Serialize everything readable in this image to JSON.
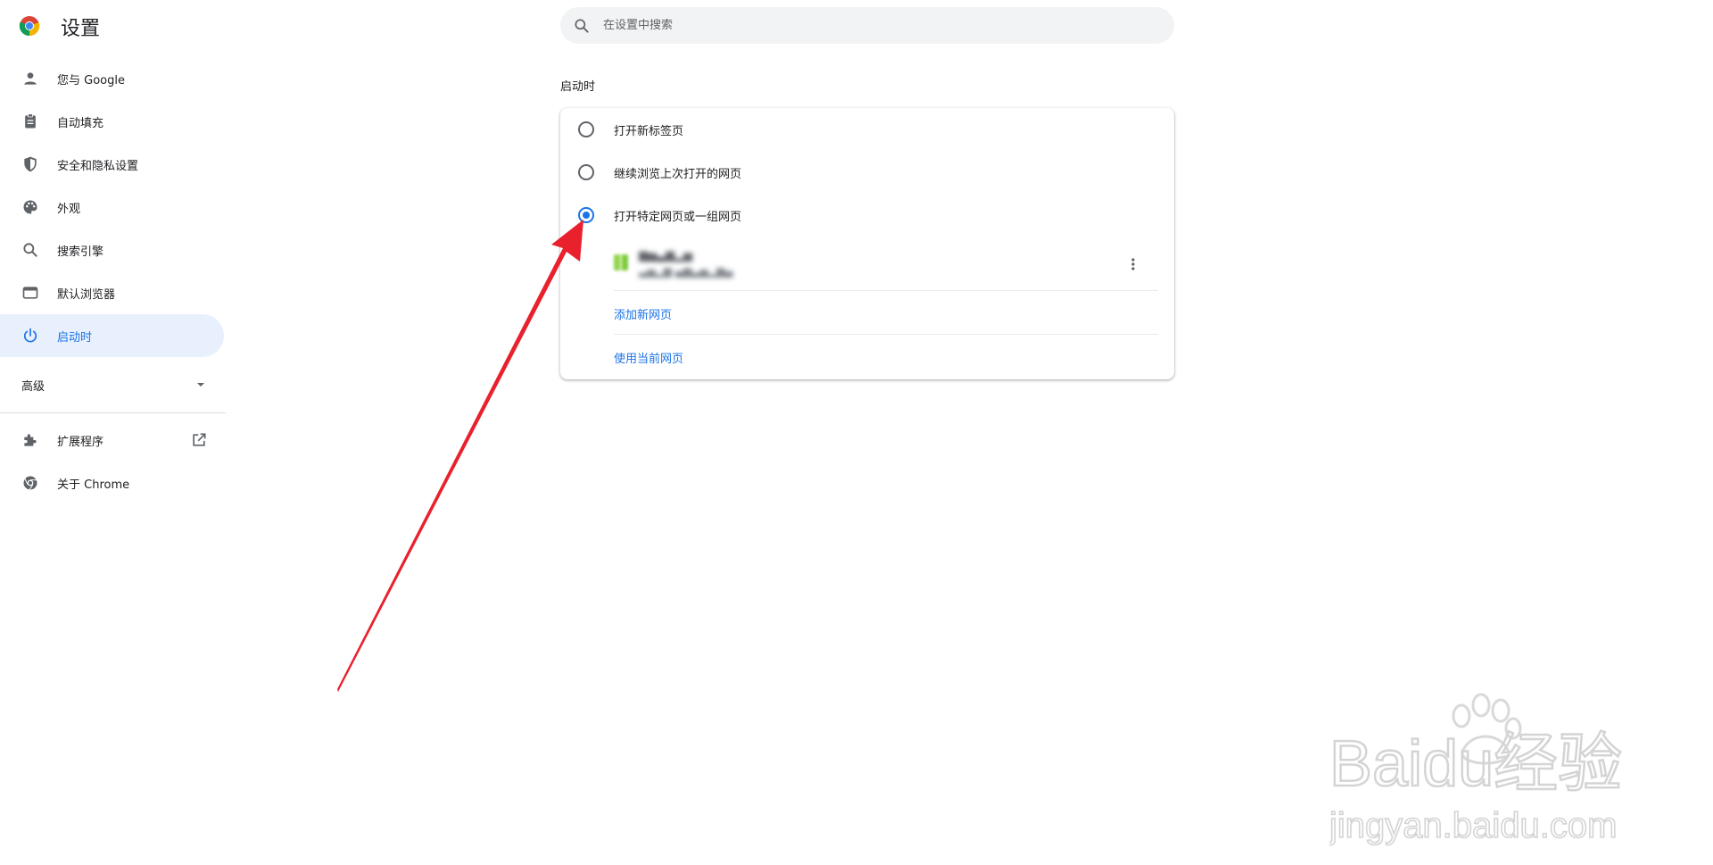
{
  "header": {
    "title": "设置",
    "search_placeholder": "在设置中搜索"
  },
  "sidebar": {
    "items": [
      {
        "label": "您与 Google",
        "icon": "person-icon"
      },
      {
        "label": "自动填充",
        "icon": "clipboard-icon"
      },
      {
        "label": "安全和隐私设置",
        "icon": "shield-icon"
      },
      {
        "label": "外观",
        "icon": "palette-icon"
      },
      {
        "label": "搜索引擎",
        "icon": "search-icon"
      },
      {
        "label": "默认浏览器",
        "icon": "browser-window-icon"
      },
      {
        "label": "启动时",
        "icon": "power-icon",
        "active": true
      }
    ],
    "advanced_label": "高级",
    "extensions_label": "扩展程序",
    "about_label": "关于 Chrome"
  },
  "startup": {
    "section_title": "启动时",
    "options": [
      {
        "label": "打开新标签页",
        "checked": false
      },
      {
        "label": "继续浏览上次打开的网页",
        "checked": false
      },
      {
        "label": "打开特定网页或一组网页",
        "checked": true
      }
    ],
    "add_page_link": "添加新网页",
    "use_current_link": "使用当前网页"
  },
  "colors": {
    "accent": "#1a73e8",
    "active_bg": "#e8f0fe",
    "annotation_arrow": "#e8212d"
  },
  "watermark": {
    "brand": "Baidu经验",
    "url": "jingyan.baidu.com"
  }
}
